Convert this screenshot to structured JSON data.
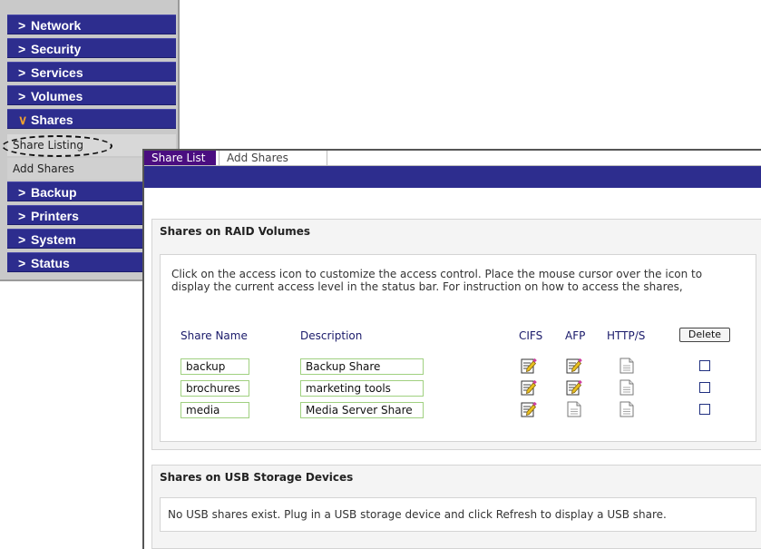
{
  "nav": {
    "items": [
      {
        "label": "Network",
        "expanded": false
      },
      {
        "label": "Security",
        "expanded": false
      },
      {
        "label": "Services",
        "expanded": false
      },
      {
        "label": "Volumes",
        "expanded": false
      },
      {
        "label": "Shares",
        "expanded": true
      },
      {
        "label": "Backup",
        "expanded": false
      },
      {
        "label": "Printers",
        "expanded": false
      },
      {
        "label": "System",
        "expanded": false
      },
      {
        "label": "Status",
        "expanded": false
      }
    ],
    "sub_items": [
      "Share Listing",
      "Add Shares"
    ]
  },
  "tabs": [
    "Share List",
    "Add Shares"
  ],
  "raid": {
    "heading": "Shares on RAID Volumes",
    "info_line1": "Click on the access icon to customize the access control. Place the mouse cursor over the icon to",
    "info_line2": "display the current access level in the status bar. For instruction on how to access the shares,",
    "columns": {
      "name": "Share Name",
      "description": "Description",
      "cifs": "CIFS",
      "afp": "AFP",
      "http": "HTTP/S"
    },
    "delete_label": "Delete",
    "rows": [
      {
        "name": "backup",
        "description": "Backup Share",
        "cifs": "enabled",
        "afp": "enabled",
        "http": "disabled"
      },
      {
        "name": "brochures",
        "description": "marketing tools",
        "cifs": "enabled",
        "afp": "enabled",
        "http": "disabled"
      },
      {
        "name": "media",
        "description": "Media Server Share",
        "cifs": "enabled",
        "afp": "disabled",
        "http": "disabled"
      }
    ]
  },
  "usb": {
    "heading": "Shares on USB Storage Devices",
    "message": "No USB shares exist. Plug in a USB storage device and click Refresh to display a USB share."
  },
  "colors": {
    "nav_blue": "#2d2d8e",
    "active_tab": "#4a0d80",
    "field_border": "#a0d080"
  }
}
